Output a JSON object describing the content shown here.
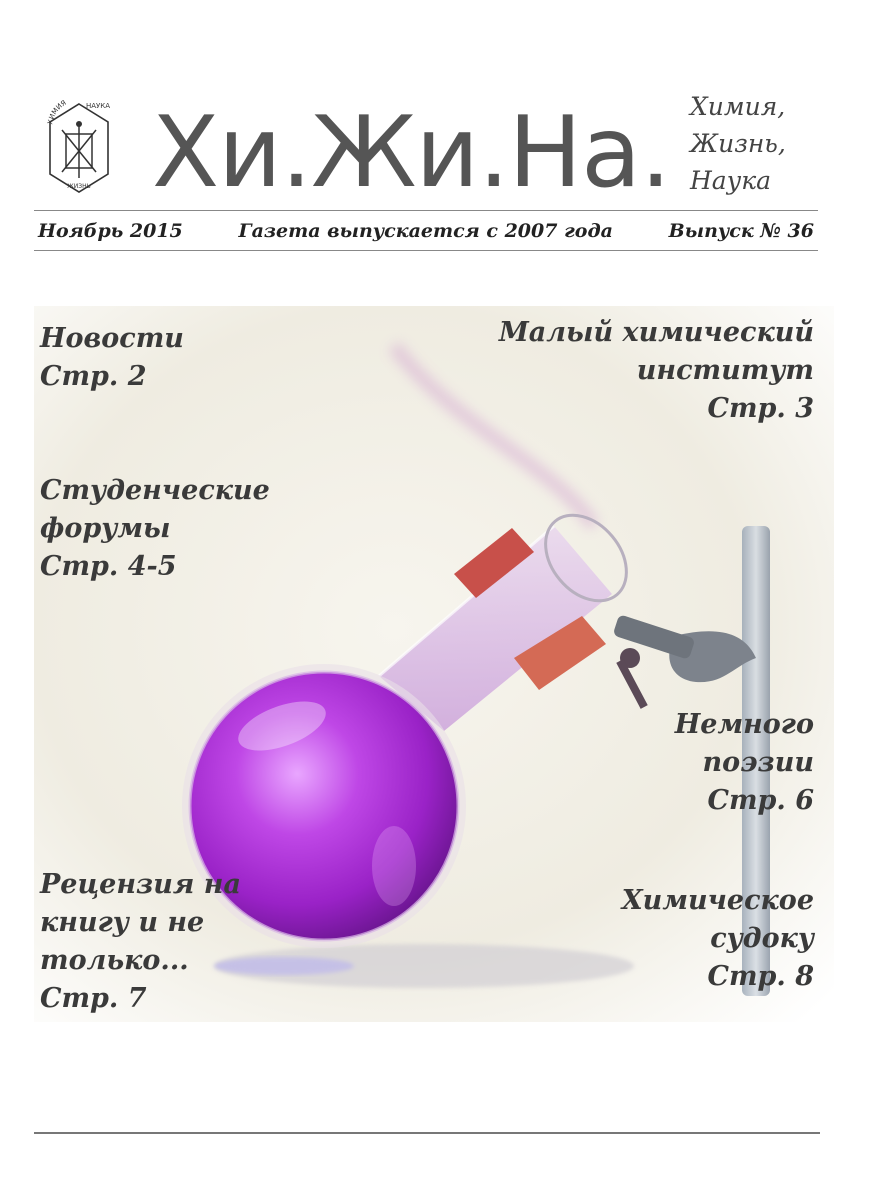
{
  "masthead": {
    "title": "Хи.Жи.На.",
    "tagline": [
      "Химия,",
      "Жизнь,",
      "Наука"
    ],
    "logo_text_top_left": "ХИМИЯ",
    "logo_text_top_right": "НАУКА",
    "logo_text_bottom": "ЖИЗНЬ"
  },
  "info_bar": {
    "date": "Ноябрь 2015",
    "since": "Газета выпускается с 2007 года",
    "issue": "Выпуск № 36"
  },
  "contents": {
    "news": [
      "Новости",
      "Стр. 2"
    ],
    "institute": [
      "Малый химический",
      "институт",
      "Стр. 3"
    ],
    "forums": [
      "Студенческие",
      "форумы",
      "Стр. 4-5"
    ],
    "poetry": [
      "Немного",
      "поэзии",
      "Стр. 6"
    ],
    "review": [
      "Рецензия на",
      "книгу и не",
      "только...",
      "Стр. 7"
    ],
    "sudoku": [
      "Химическое",
      "судоку",
      "Стр. 8"
    ]
  },
  "colors": {
    "liquid": "#b13ad8",
    "stopper": "#c8504a",
    "clamp": "#8a8f96",
    "text": "#3a3a3a"
  }
}
